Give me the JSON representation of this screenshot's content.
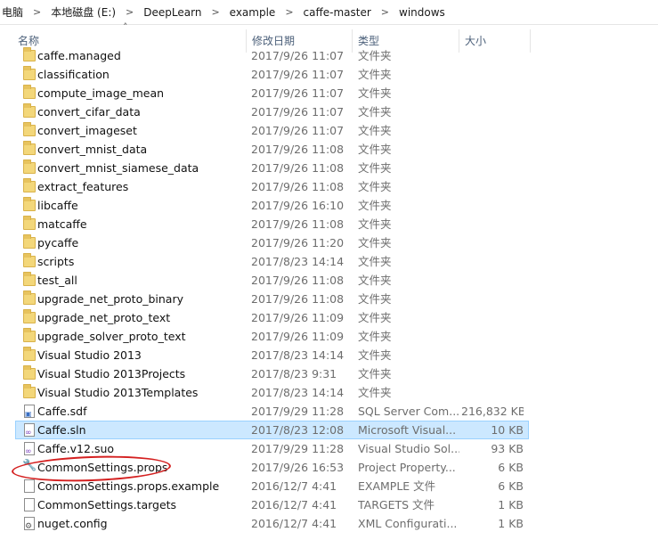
{
  "breadcrumb": [
    "电脑",
    "本地磁盘 (E:)",
    "DeepLearn",
    "example",
    "caffe-master",
    "windows"
  ],
  "columns": {
    "name": "名称",
    "date": "修改日期",
    "type": "类型",
    "size": "大小"
  },
  "files": [
    {
      "name": "caffe.managed",
      "date": "2017/9/26 11:07",
      "type": "文件夹",
      "size": "",
      "icon": "folder-icon"
    },
    {
      "name": "classification",
      "date": "2017/9/26 11:07",
      "type": "文件夹",
      "size": "",
      "icon": "folder-icon"
    },
    {
      "name": "compute_image_mean",
      "date": "2017/9/26 11:07",
      "type": "文件夹",
      "size": "",
      "icon": "folder-icon"
    },
    {
      "name": "convert_cifar_data",
      "date": "2017/9/26 11:07",
      "type": "文件夹",
      "size": "",
      "icon": "folder-icon"
    },
    {
      "name": "convert_imageset",
      "date": "2017/9/26 11:07",
      "type": "文件夹",
      "size": "",
      "icon": "folder-icon"
    },
    {
      "name": "convert_mnist_data",
      "date": "2017/9/26 11:08",
      "type": "文件夹",
      "size": "",
      "icon": "folder-icon"
    },
    {
      "name": "convert_mnist_siamese_data",
      "date": "2017/9/26 11:08",
      "type": "文件夹",
      "size": "",
      "icon": "folder-icon"
    },
    {
      "name": "extract_features",
      "date": "2017/9/26 11:08",
      "type": "文件夹",
      "size": "",
      "icon": "folder-icon"
    },
    {
      "name": "libcaffe",
      "date": "2017/9/26 16:10",
      "type": "文件夹",
      "size": "",
      "icon": "folder-icon"
    },
    {
      "name": "matcaffe",
      "date": "2017/9/26 11:08",
      "type": "文件夹",
      "size": "",
      "icon": "folder-icon"
    },
    {
      "name": "pycaffe",
      "date": "2017/9/26 11:20",
      "type": "文件夹",
      "size": "",
      "icon": "folder-icon"
    },
    {
      "name": "scripts",
      "date": "2017/8/23 14:14",
      "type": "文件夹",
      "size": "",
      "icon": "folder-icon"
    },
    {
      "name": "test_all",
      "date": "2017/9/26 11:08",
      "type": "文件夹",
      "size": "",
      "icon": "folder-icon"
    },
    {
      "name": "upgrade_net_proto_binary",
      "date": "2017/9/26 11:08",
      "type": "文件夹",
      "size": "",
      "icon": "folder-icon"
    },
    {
      "name": "upgrade_net_proto_text",
      "date": "2017/9/26 11:09",
      "type": "文件夹",
      "size": "",
      "icon": "folder-icon"
    },
    {
      "name": "upgrade_solver_proto_text",
      "date": "2017/9/26 11:09",
      "type": "文件夹",
      "size": "",
      "icon": "folder-icon"
    },
    {
      "name": "Visual Studio 2013",
      "date": "2017/8/23 14:14",
      "type": "文件夹",
      "size": "",
      "icon": "folder-icon"
    },
    {
      "name": "Visual Studio 2013Projects",
      "date": "2017/8/23 9:31",
      "type": "文件夹",
      "size": "",
      "icon": "folder-icon"
    },
    {
      "name": "Visual Studio 2013Templates",
      "date": "2017/8/23 14:14",
      "type": "文件夹",
      "size": "",
      "icon": "folder-icon"
    },
    {
      "name": "Caffe.sdf",
      "date": "2017/9/29 11:28",
      "type": "SQL Server Com...",
      "size": "216,832 KB",
      "icon": "sdf-file-icon"
    },
    {
      "name": "Caffe.sln",
      "date": "2017/8/23 12:08",
      "type": "Microsoft Visual...",
      "size": "10 KB",
      "icon": "vs-solution-icon",
      "selected": true
    },
    {
      "name": "Caffe.v12.suo",
      "date": "2017/9/29 11:28",
      "type": "Visual Studio Sol...",
      "size": "93 KB",
      "icon": "suo-file-icon"
    },
    {
      "name": "CommonSettings.props",
      "date": "2017/9/26 16:53",
      "type": "Project Property...",
      "size": "6 KB",
      "icon": "wrench-icon",
      "circled": true
    },
    {
      "name": "CommonSettings.props.example",
      "date": "2016/12/7 4:41",
      "type": "EXAMPLE 文件",
      "size": "6 KB",
      "icon": "file-icon"
    },
    {
      "name": "CommonSettings.targets",
      "date": "2016/12/7 4:41",
      "type": "TARGETS 文件",
      "size": "1 KB",
      "icon": "file-icon"
    },
    {
      "name": "nuget.config",
      "date": "2016/12/7 4:41",
      "type": "XML Configurati...",
      "size": "1 KB",
      "icon": "config-file-icon"
    }
  ]
}
